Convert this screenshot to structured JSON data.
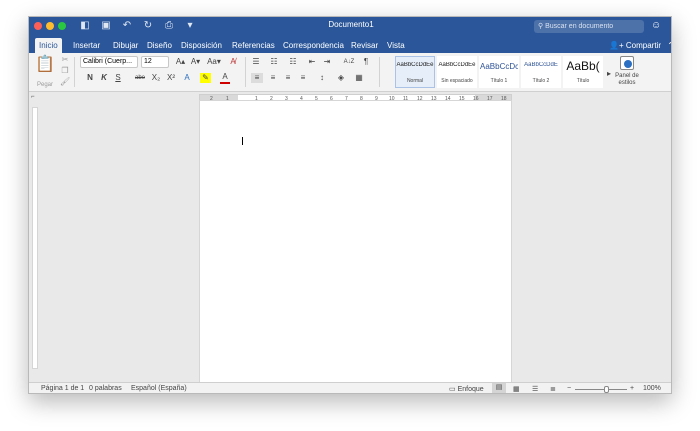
{
  "window": {
    "title": "Documento1",
    "search_placeholder": "Buscar en documento",
    "smiley": "☺",
    "traffic_colors": [
      "#fd5f57",
      "#febb2e",
      "#29c840"
    ]
  },
  "quick_access": {
    "icons": [
      "sidebar-icon",
      "save-icon",
      "undo-icon",
      "redo-icon",
      "print-icon",
      "customize-icon"
    ],
    "glyphs": [
      "◧",
      "▣",
      "↶",
      "↻",
      "⎙",
      "▾"
    ]
  },
  "tabs": [
    "Inicio",
    "Insertar",
    "Dibujar",
    "Diseño",
    "Disposición",
    "Referencias",
    "Correspondencia",
    "Revisar",
    "Vista"
  ],
  "active_tab": 0,
  "share": {
    "label": "Compartir",
    "icon": "share-icon",
    "collapse": "⌃"
  },
  "ribbon": {
    "paste_label": "Pegar",
    "font_name": "Calibri (Cuerp...",
    "font_size": "12",
    "grow": "A▴",
    "shrink": "A▾",
    "change_case": "Aa▾",
    "clear_format": "A̸",
    "bold": "N",
    "italic": "K",
    "underline": "S",
    "strike": "abe",
    "subscript": "X₂",
    "superscript": "X²",
    "text_effects": "A",
    "highlight": "✎",
    "font_color": "A",
    "bullets": "☰",
    "numbering": "☷",
    "multilevel": "☷",
    "decrease_indent": "⇤",
    "increase_indent": "⇥",
    "sort": "A↓Z",
    "pilcrow": "¶",
    "align_left": "≡",
    "align_center": "≡",
    "align_right": "≡",
    "justify": "≡",
    "line_spacing": "↕",
    "shading": "◈",
    "borders": "▦",
    "styles": [
      {
        "preview": "AaBbCcDdEe",
        "name": "Normal"
      },
      {
        "preview": "AaBbCcDdEe",
        "name": "Sin espaciado"
      },
      {
        "preview": "AaBbCcDc",
        "name": "Título 1"
      },
      {
        "preview": "AaBbCcDdE",
        "name": "Título 2"
      },
      {
        "preview": "AaBb(",
        "name": "Título"
      }
    ],
    "styles_more": "▸",
    "styles_pane_label": "Panel de estilos"
  },
  "ruler": {
    "numbers": [
      "2",
      "1",
      "",
      "1",
      "2",
      "3",
      "4",
      "5",
      "6",
      "7",
      "8",
      "9",
      "10",
      "11",
      "12",
      "13",
      "14",
      "15",
      "16",
      "17",
      "18"
    ]
  },
  "status": {
    "page": "Página 1 de 1",
    "words": "0 palabras",
    "language": "Español (España)",
    "focus": "Enfoque",
    "zoom_minus": "−",
    "zoom_plus": "+",
    "zoom_level": 1.0,
    "zoom": "100%"
  },
  "colors": {
    "accent": "#2b579a",
    "highlight_yellow": "#ffff00",
    "font_red": "#d00000"
  }
}
